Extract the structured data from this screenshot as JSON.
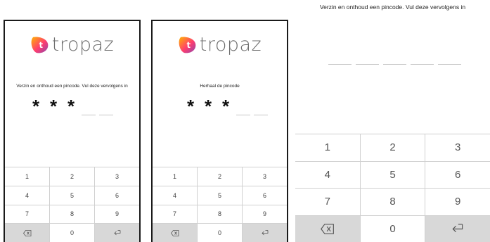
{
  "brand": {
    "name": "tropaz",
    "mark_letter": "t",
    "colors": [
      "#ffb300",
      "#ff3d6e",
      "#8e44ad"
    ]
  },
  "screens": [
    {
      "prompt": "Verzin en onthoud een pincode. Vul deze vervolgens in",
      "pin": {
        "filled": [
          "*",
          "*",
          "*"
        ],
        "empty_count": 2
      },
      "keypad": {
        "keys": [
          "1",
          "2",
          "3",
          "4",
          "5",
          "6",
          "7",
          "8",
          "9"
        ],
        "zero": "0",
        "backspace_icon": "backspace-icon",
        "enter_icon": "enter-icon"
      }
    },
    {
      "prompt": "Herhaal de pincode",
      "pin": {
        "filled": [
          "*",
          "*",
          "*"
        ],
        "empty_count": 2
      },
      "keypad": {
        "keys": [
          "1",
          "2",
          "3",
          "4",
          "5",
          "6",
          "7",
          "8",
          "9"
        ],
        "zero": "0",
        "backspace_icon": "backspace-icon",
        "enter_icon": "enter-icon"
      }
    },
    {
      "prompt": "Verzin en onthoud een pincode. Vul deze vervolgens in",
      "pin": {
        "filled": [],
        "empty_count": 5
      },
      "keypad": {
        "keys": [
          "1",
          "2",
          "3",
          "4",
          "5",
          "6",
          "7",
          "8",
          "9"
        ],
        "zero": "0",
        "backspace_icon": "backspace-icon",
        "enter_icon": "enter-icon"
      }
    }
  ]
}
